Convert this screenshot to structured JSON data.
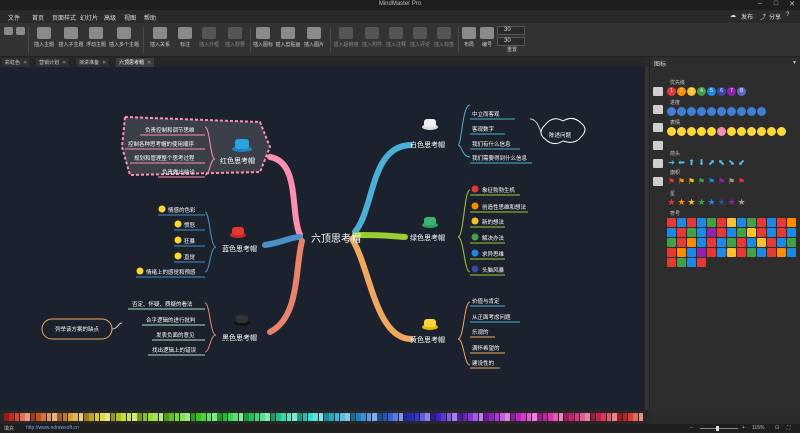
{
  "window": {
    "title": "MindMaster Pro"
  },
  "menu": {
    "items": [
      "文件",
      "首页",
      "页面样式",
      "幻灯片",
      "高级",
      "视图",
      "帮助"
    ],
    "publish": "发布",
    "share": "分享"
  },
  "ribbon": {
    "insert_topic": "插入主题",
    "insert_subtopic": "插入子主题",
    "floating_topic": "浮动主题",
    "insert_multiple": "插入多个主题",
    "insert_relation": "插入关系",
    "callout": "标注",
    "insert_outline": "插入外框",
    "insert_summary": "插入概要",
    "insert_icon": "插入图标",
    "insert_clipart": "插入剪贴画",
    "insert_image": "插入图片",
    "insert_hyperlink": "插入超链接",
    "insert_attachment": "插入附件",
    "insert_note": "插入注释",
    "insert_comment": "插入评论",
    "insert_tag": "插入标签",
    "layout": "布局",
    "numbering": "编号",
    "spacing_value": "30",
    "reset": "重置"
  },
  "tabs": [
    {
      "label": "彩虹色"
    },
    {
      "label": "营销计划"
    },
    {
      "label": "演讲准备"
    },
    {
      "label": "六顶思考帽"
    }
  ],
  "mindmap": {
    "central": "六顶思考帽",
    "branches": {
      "white": {
        "label": "白色思考帽",
        "items": [
          "中立而客观",
          "客观数字",
          "我们有什么信息",
          "我们需要得到什么信息"
        ],
        "callout": "陈述问题"
      },
      "green": {
        "label": "绿色思考帽",
        "items": [
          "象征勃勃生机",
          "创造性思维和想法",
          "新的想法",
          "解决办法",
          "求异思维",
          "头脑风暴"
        ]
      },
      "yellow": {
        "label": "黄色思考帽",
        "items": [
          "价值与肯定",
          "从正面考虑问题",
          "乐观的",
          "满怀希望的",
          "建设性的"
        ]
      },
      "red": {
        "label": "红色思考帽",
        "items": [
          "负责控制和调节思维",
          "控制各种思考帽的使用顺序",
          "规划和管理整个思考过程",
          "负责做出结论"
        ]
      },
      "blue": {
        "label": "蓝色思考帽",
        "items": [
          "情感的色彩",
          "愤怒",
          "狂暴",
          "直觉",
          "情绪上的感觉和预感"
        ]
      },
      "black": {
        "label": "黑色思考帽",
        "items": [
          "否定、怀疑、质疑的看法",
          "合乎逻辑的进行批判",
          "发表负面的意见",
          "找出逻辑上的错误"
        ],
        "callout": "列举该方案的缺点"
      }
    }
  },
  "panel": {
    "title": "图标",
    "sections": [
      "优先级",
      "进度",
      "表情",
      "箭头",
      "旗帜",
      "星",
      "符号"
    ],
    "priority_numbers": [
      "1",
      "2",
      "3",
      "4",
      "5",
      "6",
      "7",
      "8"
    ]
  },
  "statusbar": {
    "fill_label": "填充",
    "url": "http://www.edrawsoft.cn",
    "zoom": "115%"
  },
  "colors": {
    "canvas_bg": "#1c222d",
    "white_branch": "#49b0d8",
    "green_branch": "#9acd32",
    "yellow_branch": "#f0a75f",
    "red_branch": "#ff8fb1",
    "blue_branch": "#4a90c8",
    "black_branch": "#a8e0d0"
  }
}
